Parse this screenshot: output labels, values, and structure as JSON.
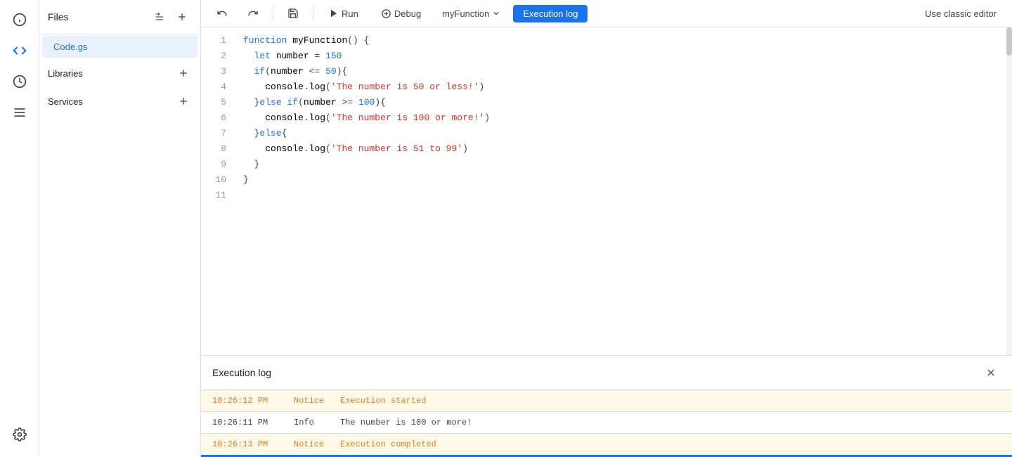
{
  "iconRail": {
    "items": [
      {
        "name": "info-icon",
        "symbol": "ℹ",
        "active": false
      },
      {
        "name": "code-icon",
        "symbol": "<>",
        "active": true
      },
      {
        "name": "clock-icon",
        "symbol": "⏱",
        "active": false
      },
      {
        "name": "list-icon",
        "symbol": "≡",
        "active": false
      },
      {
        "name": "gear-icon",
        "symbol": "⚙",
        "active": false
      }
    ]
  },
  "filePanel": {
    "title": "Files",
    "files": [
      {
        "name": "Code.gs",
        "active": true
      }
    ],
    "sections": [
      {
        "label": "Libraries"
      },
      {
        "label": "Services"
      }
    ]
  },
  "toolbar": {
    "undo_title": "Undo",
    "redo_title": "Redo",
    "save_title": "Save",
    "run_label": "Run",
    "debug_label": "Debug",
    "function_label": "myFunction",
    "execution_log_label": "Execution log",
    "use_classic_label": "Use classic editor"
  },
  "editor": {
    "lines": [
      {
        "num": 1,
        "html": "kw:function fn:myFunction op:() op:{"
      },
      {
        "num": 2,
        "html": "  kw:let var:number op:= num:150"
      },
      {
        "num": 3,
        "html": "  kw:if op:(var:number op:<= num:50 op:){"
      },
      {
        "num": 4,
        "html": "    var:console op:.var:log op:(str:'The number is 50 or less!' op:)"
      },
      {
        "num": 5,
        "html": "  op:}kw:else kw:if op:(var:number op:>= num:100 op:){"
      },
      {
        "num": 6,
        "html": "    var:console op:.var:log op:(str:'The number is 100 or more!' op:)"
      },
      {
        "num": 7,
        "html": "  op:}kw:else op:{"
      },
      {
        "num": 8,
        "html": "    var:console op:.var:log op:(str:'The number is 51 to 99' op:)"
      },
      {
        "num": 9,
        "html": "  op:}"
      },
      {
        "num": 10,
        "html": "op:}"
      },
      {
        "num": 11,
        "html": ""
      }
    ]
  },
  "executionLog": {
    "title": "Execution log",
    "entries": [
      {
        "time": "10:26:12 PM",
        "level": "Notice",
        "message": "Execution started",
        "type": "notice"
      },
      {
        "time": "10:26:11 PM",
        "level": "Info",
        "message": "The number is 100 or more!",
        "type": "info"
      },
      {
        "time": "10:26:13 PM",
        "level": "Notice",
        "message": "Execution completed",
        "type": "notice"
      }
    ]
  }
}
